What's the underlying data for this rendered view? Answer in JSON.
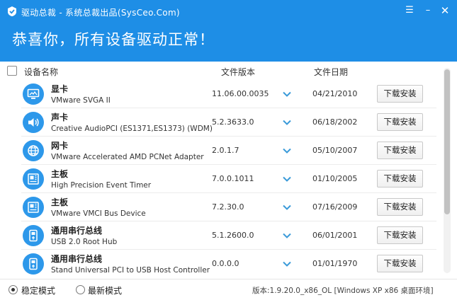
{
  "window": {
    "title": "驱动总裁 - 系统总裁出品(SysCeo.Com)",
    "settings_glyph": "☰",
    "minimize_glyph": "–",
    "close_glyph": "✕"
  },
  "header": {
    "headline": "恭喜你，所有设备驱动正常！"
  },
  "columns": {
    "name": "设备名称",
    "version": "文件版本",
    "date": "文件日期"
  },
  "devices": [
    {
      "category": "显卡",
      "name": "VMware SVGA II",
      "version": "11.06.00.0035",
      "date": "04/21/2010",
      "action": "下载安装",
      "icon": "monitor-icon"
    },
    {
      "category": "声卡",
      "name": "Creative AudioPCI (ES1371,ES1373) (WDM)",
      "version": "5.2.3633.0",
      "date": "06/18/2002",
      "action": "下载安装",
      "icon": "speaker-icon"
    },
    {
      "category": "网卡",
      "name": "VMware Accelerated AMD PCNet Adapter",
      "version": "2.0.1.7",
      "date": "05/10/2007",
      "action": "下载安装",
      "icon": "globe-icon"
    },
    {
      "category": "主板",
      "name": "High Precision Event Timer",
      "version": "7.0.0.1011",
      "date": "01/10/2005",
      "action": "下载安装",
      "icon": "motherboard-icon"
    },
    {
      "category": "主板",
      "name": "VMware VMCI Bus Device",
      "version": "7.2.30.0",
      "date": "07/16/2009",
      "action": "下载安装",
      "icon": "motherboard-icon"
    },
    {
      "category": "通用串行总线",
      "name": "USB 2.0 Root Hub",
      "version": "5.1.2600.0",
      "date": "06/01/2001",
      "action": "下载安装",
      "icon": "usb-icon"
    },
    {
      "category": "通用串行总线",
      "name": "Stand Universal PCI to USB Host Controller",
      "version": "0.0.0.0",
      "date": "01/01/1970",
      "action": "下载安装",
      "icon": "usb-icon"
    }
  ],
  "footer": {
    "mode_stable": "稳定模式",
    "mode_latest": "最新模式",
    "selected_mode": "stable",
    "version_info": "版本:1.9.20.0_x86_OL [Windows XP x86 桌面环境]"
  },
  "colors": {
    "accent": "#1e8ee6",
    "icon_bg": "#2d98ea",
    "chevron": "#3a9ad9"
  }
}
